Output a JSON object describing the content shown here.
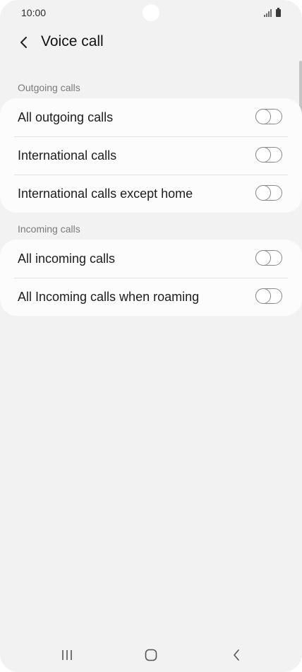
{
  "status_bar": {
    "time": "10:00",
    "icons": [
      "signal-icon",
      "battery-icon"
    ]
  },
  "header": {
    "back_icon": "chevron-left-icon",
    "title": "Voice call"
  },
  "sections": [
    {
      "header": "Outgoing calls",
      "items": [
        {
          "label": "All outgoing calls",
          "enabled": false
        },
        {
          "label": "International calls",
          "enabled": false
        },
        {
          "label": "International calls except home",
          "enabled": false
        }
      ]
    },
    {
      "header": "Incoming calls",
      "items": [
        {
          "label": "All incoming calls",
          "enabled": false
        },
        {
          "label": "All Incoming calls when roaming",
          "enabled": false
        }
      ]
    }
  ],
  "nav_bar": {
    "icons": [
      "recent-apps-icon",
      "home-icon",
      "back-icon"
    ]
  },
  "colors": {
    "background": "#f2f2f2",
    "card": "#fcfcfc",
    "section_header": "#7a7a7a",
    "text": "#1d1d1d",
    "toggle_off": "#8a8a8a"
  }
}
